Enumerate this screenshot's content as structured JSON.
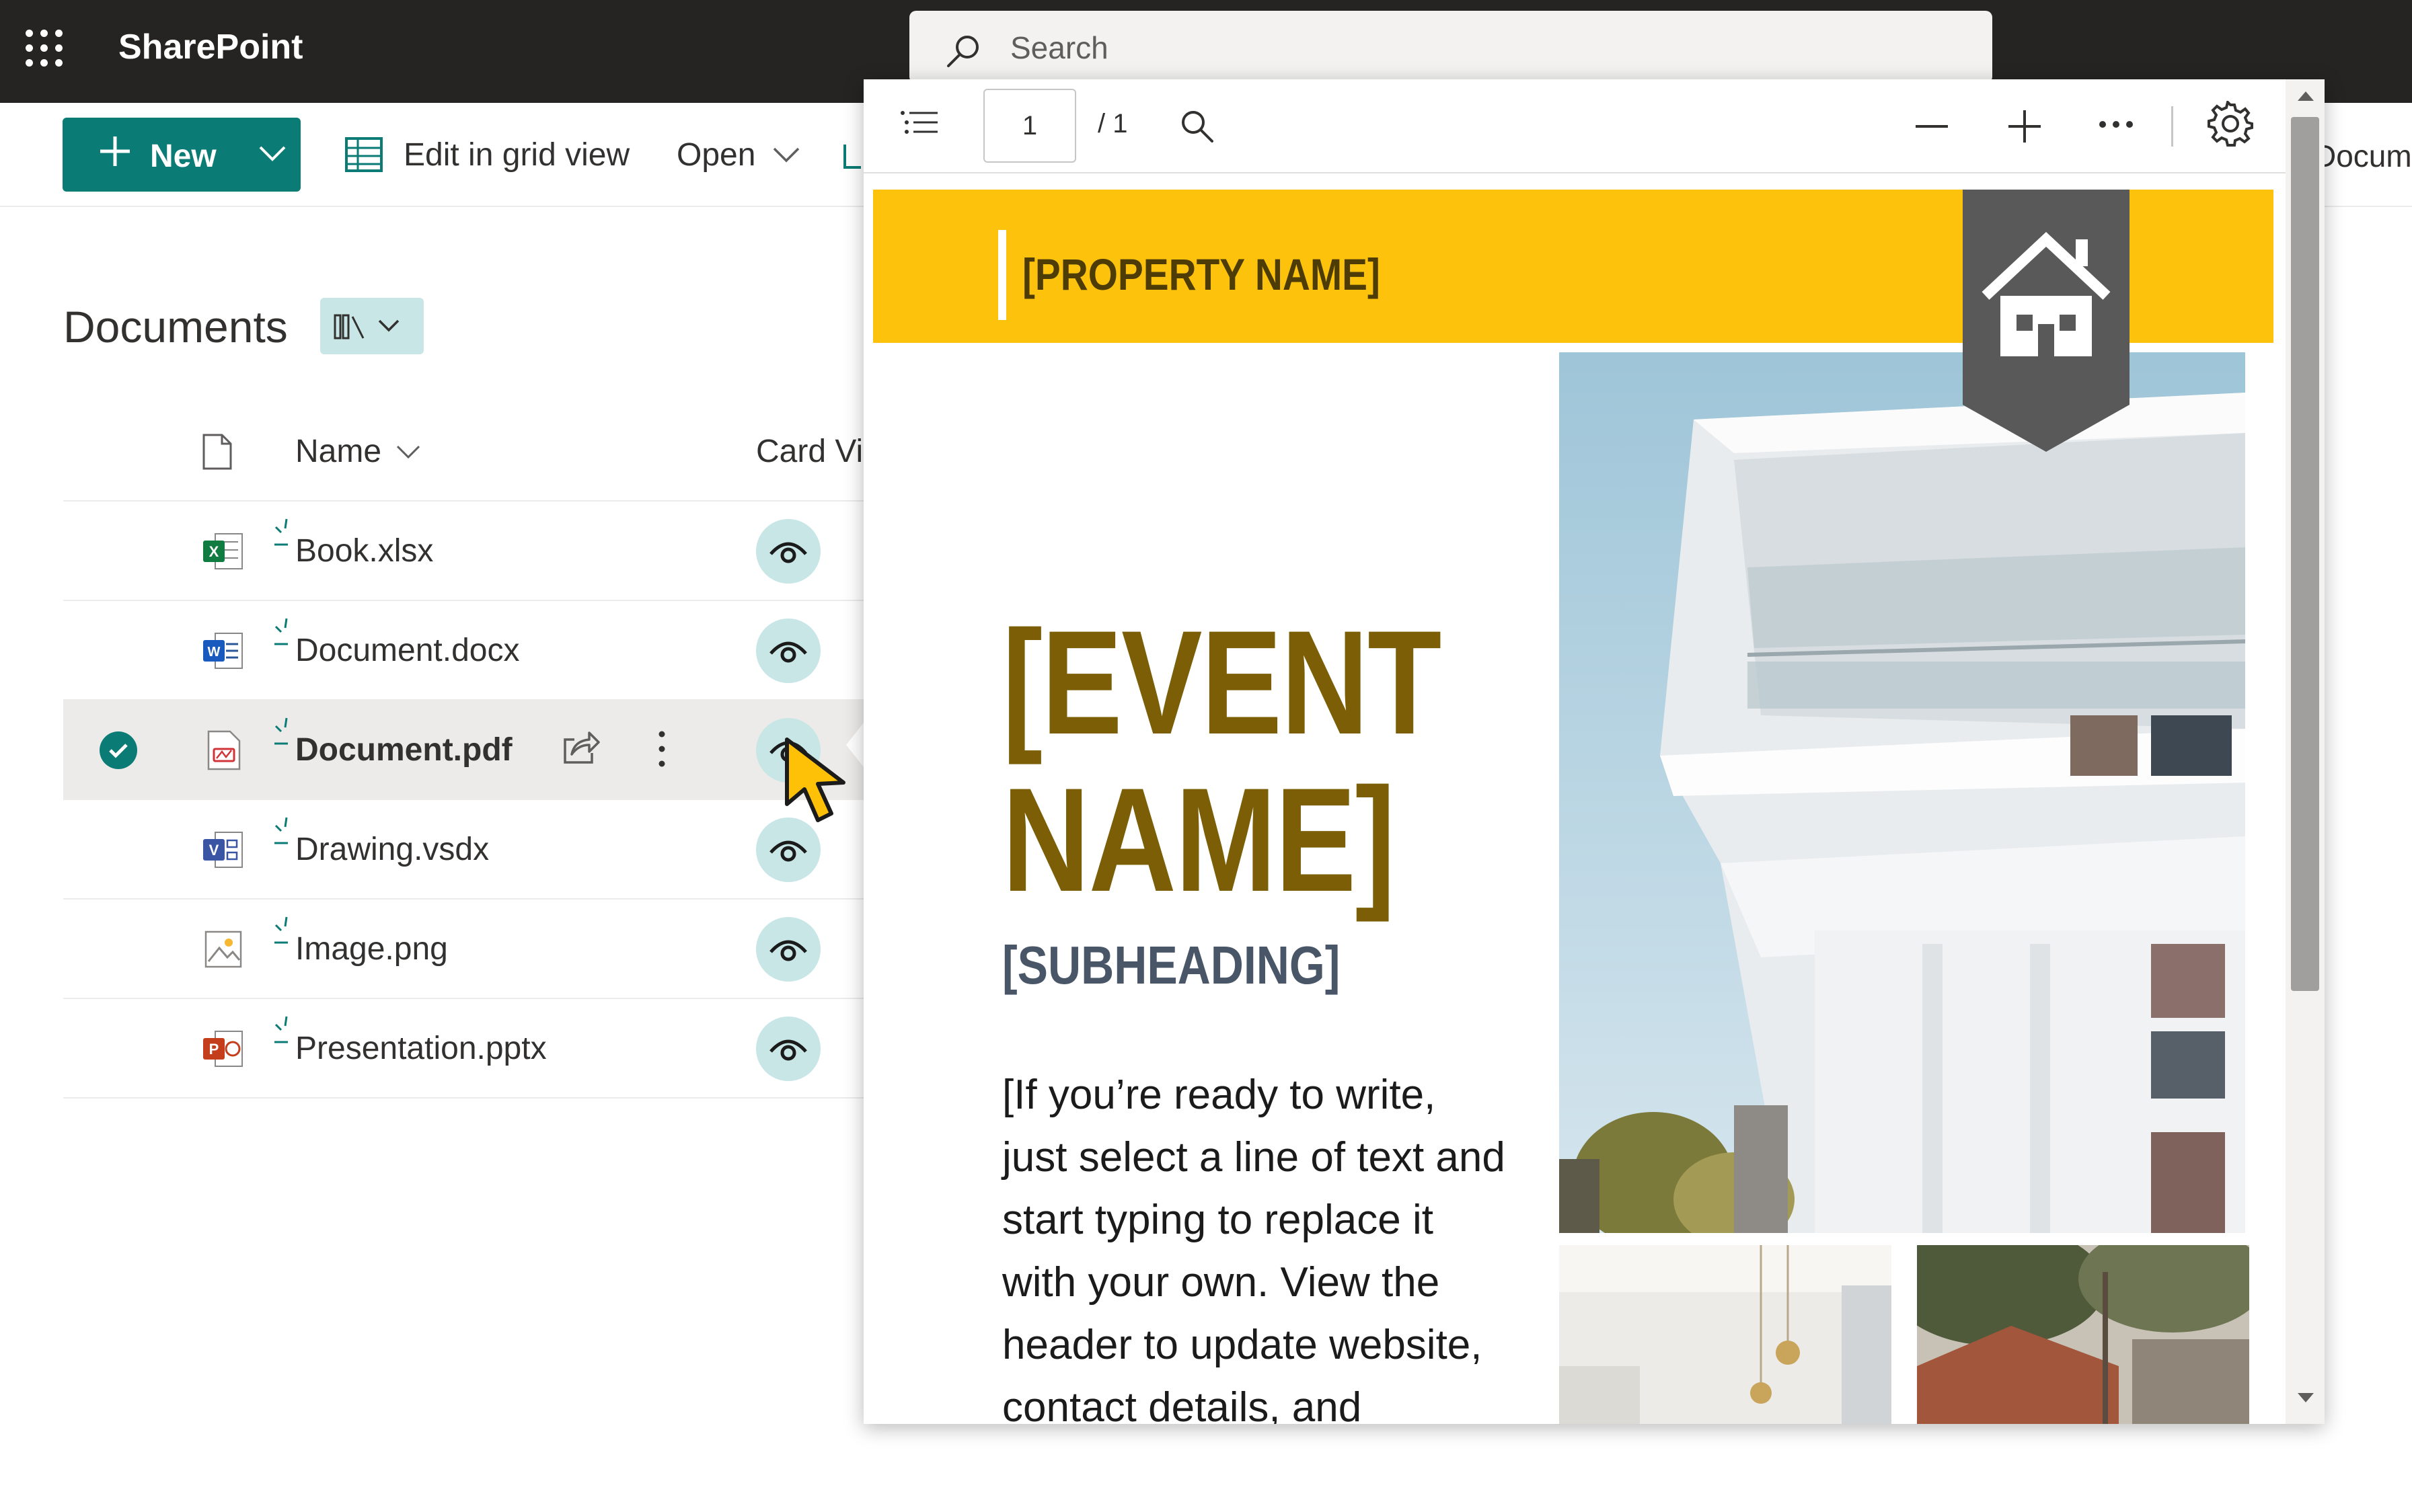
{
  "suite": {
    "app_name": "SharePoint",
    "search_placeholder": "Search"
  },
  "commandbar": {
    "new_label": "New",
    "edit_grid_label": "Edit in grid view",
    "open_label": "Open",
    "right_partial_label": "Docum"
  },
  "library": {
    "title": "Documents",
    "columns": {
      "name": "Name",
      "card": "Card Vi"
    },
    "files": [
      {
        "name": "Book.xlsx",
        "type": "excel",
        "selected": false
      },
      {
        "name": "Document.docx",
        "type": "word",
        "selected": false
      },
      {
        "name": "Document.pdf",
        "type": "pdf",
        "selected": true
      },
      {
        "name": "Drawing.vsdx",
        "type": "visio",
        "selected": false
      },
      {
        "name": "Image.png",
        "type": "image",
        "selected": false
      },
      {
        "name": "Presentation.pptx",
        "type": "powerpoint",
        "selected": false
      }
    ]
  },
  "preview": {
    "page_current": "1",
    "page_total": "/ 1",
    "pdf": {
      "property_name": "[PROPERTY NAME]",
      "event_name_line1": "[EVENT",
      "event_name_line2": "NAME]",
      "subheading": "[SUBHEADING]",
      "body_lines": [
        "[If you’re ready to write,",
        "just select a line of text and",
        "start typing to replace it",
        "with your own. View the",
        "header to update website,",
        "contact details, and"
      ]
    }
  },
  "colors": {
    "suite_bg": "#252423",
    "accent_teal": "#0b7b75",
    "eye_bg": "#c7e6e5",
    "banner_yellow": "#fcc20c",
    "event_brown": "#7b5e06",
    "subheading_slate": "#495668",
    "cursor_yellow": "#ffc107"
  },
  "icons": {
    "app_launcher": "waffle-icon",
    "search": "search-icon",
    "new": "plus-icon",
    "grid": "grid-icon",
    "library_view": "library-icon",
    "file_header": "document-icon",
    "check": "checkmark-icon",
    "share": "share-icon",
    "more": "more-vertical-icon",
    "preview": "eye-icon",
    "toc": "table-of-contents-icon",
    "find": "search-icon",
    "zoom_out": "minus-icon",
    "zoom_in": "plus-icon",
    "more_options": "more-horizontal-icon",
    "settings": "gear-icon",
    "house": "house-icon"
  }
}
